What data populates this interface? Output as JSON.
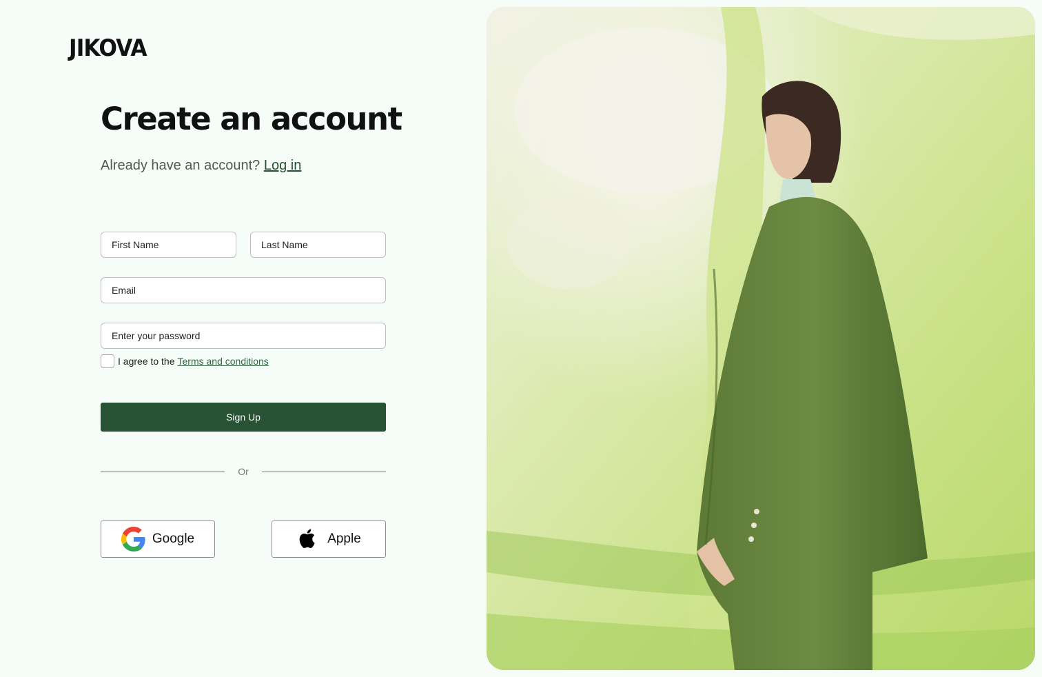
{
  "brand": {
    "logo": "JIKOVA"
  },
  "header": {
    "title": "Create an account",
    "subtitle": "Already have an account?",
    "login_link": "Log in"
  },
  "form": {
    "first_name_placeholder": "First Name",
    "last_name_placeholder": "Last Name",
    "email_placeholder": "Email",
    "password_placeholder": "Enter your password",
    "agree_text": "I agree to the",
    "terms_link": "Terms and conditions",
    "signup_label": "Sign Up"
  },
  "divider": {
    "label": "Or"
  },
  "social": {
    "google_label": "Google",
    "google_icon": "google-icon",
    "apple_label": "Apple",
    "apple_icon": "apple-icon"
  },
  "colors": {
    "background": "#f6fdf8",
    "accent": "#275234",
    "link": "#245033"
  }
}
